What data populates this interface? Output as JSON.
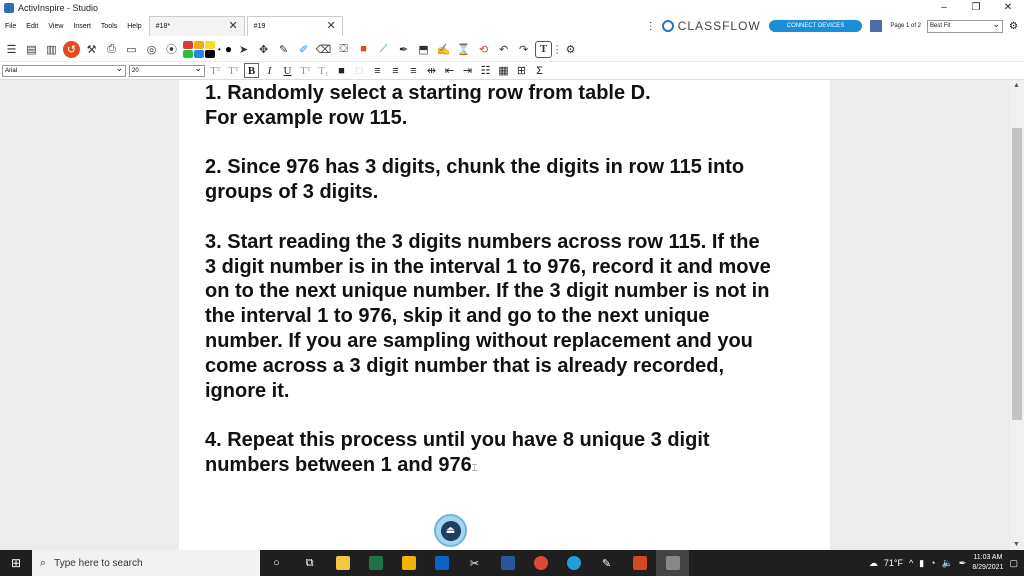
{
  "window": {
    "title": "ActivInspire - Studio",
    "minimize": "–",
    "maximize": "❐",
    "close": "✕"
  },
  "menu": [
    "File",
    "Edit",
    "View",
    "Insert",
    "Tools",
    "Help"
  ],
  "tabs": [
    {
      "label": "#18*",
      "close": "✕"
    },
    {
      "label": "#19",
      "close": "✕"
    }
  ],
  "classflow": {
    "logo": "CLASSFLOW",
    "connect_label": "CONNECT DEVICES",
    "page_info": "Page 1 of 2",
    "zoom": "Best Fit",
    "more": "⋮"
  },
  "font": {
    "family": "Arial",
    "size": "20"
  },
  "format": {
    "bold": "B",
    "italic": "I",
    "underline": "U",
    "sum": "Σ"
  },
  "content": {
    "p1": "1.  Randomly select a starting row from table D.\nFor example row 115.",
    "p2": "2.  Since 976 has 3 digits, chunk the digits in row 115 into\ngroups of 3 digits.",
    "p3": "3.  Start reading the 3 digits numbers across row 115.  If the\n3 digit number is in the interval 1 to 976, record it and move\non to the next unique number.  If the 3 digit number is not in\nthe interval 1 to 976, skip it and go to the next unique\nnumber.  If you are sampling without replacement and you\ncome across a 3 digit number that is already recorded,\nignore it.",
    "p4a": "4.  Repeat this process until you have 8 unique 3 digit",
    "p4b": "numbers between 1 and 976"
  },
  "taskbar": {
    "search_placeholder": "Type here to search",
    "temperature": "71°F",
    "time": "11:03 AM",
    "date": "8/29/2021"
  },
  "colors": {
    "swatches": [
      "#e53935",
      "#f5a623",
      "#f4e02a",
      "#26c13a",
      "#1e88e5",
      "#000000"
    ]
  }
}
